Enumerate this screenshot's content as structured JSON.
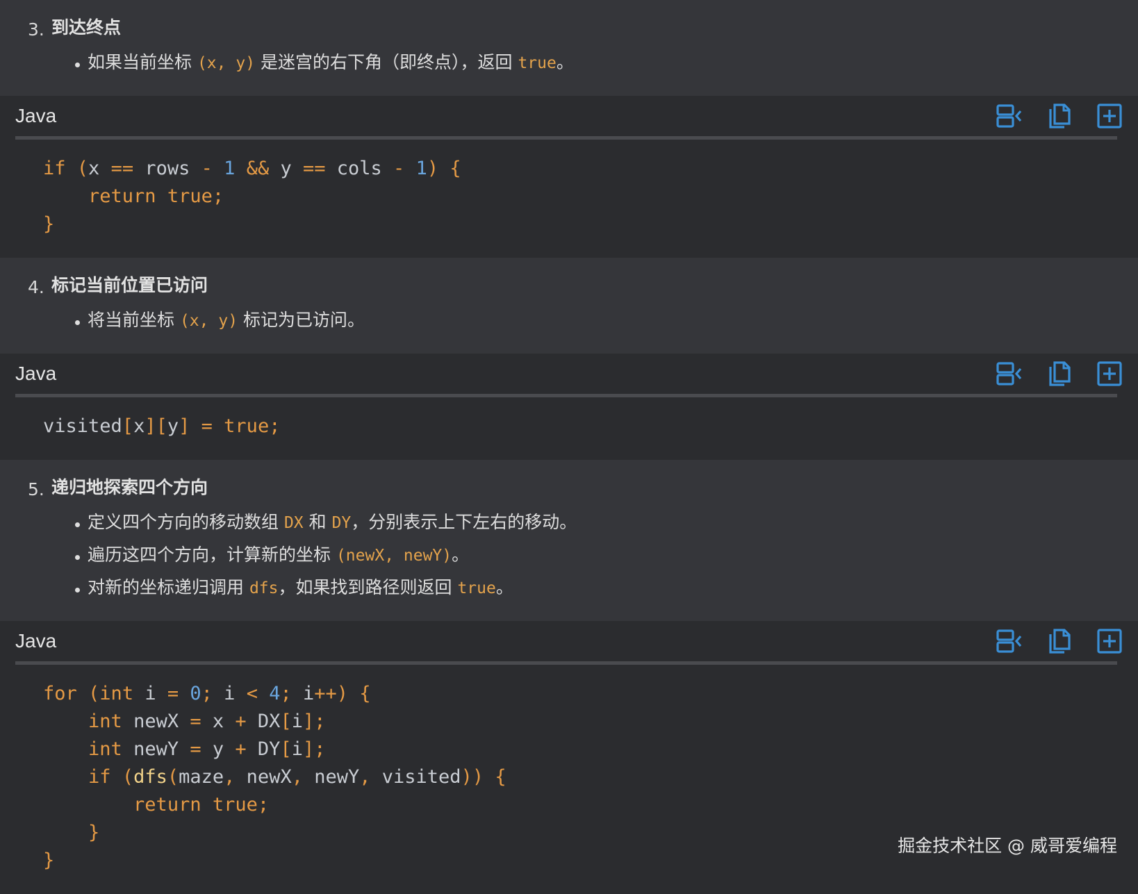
{
  "sections": [
    {
      "num": "3.",
      "title": "到达终点",
      "bullets": [
        [
          {
            "t": "如果当前坐标 "
          },
          {
            "t": "(x, y)",
            "code": true
          },
          {
            "t": " 是迷宫的右下角（即终点），返回 "
          },
          {
            "t": "true",
            "code": true
          },
          {
            "t": "。"
          }
        ]
      ]
    },
    {
      "num": "4.",
      "title": "标记当前位置已访问",
      "bullets": [
        [
          {
            "t": "将当前坐标 "
          },
          {
            "t": "(x, y)",
            "code": true
          },
          {
            "t": " 标记为已访问。"
          }
        ]
      ]
    },
    {
      "num": "5.",
      "title": "递归地探索四个方向",
      "bullets": [
        [
          {
            "t": "定义四个方向的移动数组 "
          },
          {
            "t": "DX",
            "code": true
          },
          {
            "t": " 和 "
          },
          {
            "t": "DY",
            "code": true
          },
          {
            "t": "，分别表示上下左右的移动。"
          }
        ],
        [
          {
            "t": "遍历这四个方向，计算新的坐标 "
          },
          {
            "t": "(newX, newY)",
            "code": true
          },
          {
            "t": "。"
          }
        ],
        [
          {
            "t": "对新的坐标递归调用 "
          },
          {
            "t": "dfs",
            "code": true
          },
          {
            "t": "，如果找到路径则返回 "
          },
          {
            "t": "true",
            "code": true
          },
          {
            "t": "。"
          }
        ]
      ]
    }
  ],
  "code_blocks": [
    {
      "lang": "Java",
      "lines": [
        [
          {
            "t": "if",
            "c": "kw"
          },
          {
            "t": " "
          },
          {
            "t": "(",
            "c": "op"
          },
          {
            "t": "x "
          },
          {
            "t": "==",
            "c": "op"
          },
          {
            "t": " rows "
          },
          {
            "t": "-",
            "c": "op"
          },
          {
            "t": " "
          },
          {
            "t": "1",
            "c": "num"
          },
          {
            "t": " "
          },
          {
            "t": "&&",
            "c": "op"
          },
          {
            "t": " y "
          },
          {
            "t": "==",
            "c": "op"
          },
          {
            "t": " cols "
          },
          {
            "t": "-",
            "c": "op"
          },
          {
            "t": " "
          },
          {
            "t": "1",
            "c": "num"
          },
          {
            "t": ")",
            "c": "op"
          },
          {
            "t": " "
          },
          {
            "t": "{",
            "c": "op"
          }
        ],
        [
          {
            "t": "    "
          },
          {
            "t": "return true;",
            "c": "kw"
          }
        ],
        [
          {
            "t": "}",
            "c": "op"
          }
        ]
      ]
    },
    {
      "lang": "Java",
      "lines": [
        [
          {
            "t": "visited"
          },
          {
            "t": "[",
            "c": "op"
          },
          {
            "t": "x"
          },
          {
            "t": "][",
            "c": "op"
          },
          {
            "t": "y"
          },
          {
            "t": "]",
            "c": "op"
          },
          {
            "t": " "
          },
          {
            "t": "=",
            "c": "op"
          },
          {
            "t": " "
          },
          {
            "t": "true;",
            "c": "kw"
          }
        ]
      ]
    },
    {
      "lang": "Java",
      "lines": [
        [
          {
            "t": "for",
            "c": "kw"
          },
          {
            "t": " "
          },
          {
            "t": "(int",
            "c": "kw"
          },
          {
            "t": " i "
          },
          {
            "t": "=",
            "c": "op"
          },
          {
            "t": " "
          },
          {
            "t": "0",
            "c": "num"
          },
          {
            "t": ";",
            "c": "op"
          },
          {
            "t": " i "
          },
          {
            "t": "<",
            "c": "op"
          },
          {
            "t": " "
          },
          {
            "t": "4",
            "c": "num"
          },
          {
            "t": ";",
            "c": "op"
          },
          {
            "t": " i"
          },
          {
            "t": "++)",
            "c": "op"
          },
          {
            "t": " "
          },
          {
            "t": "{",
            "c": "op"
          }
        ],
        [
          {
            "t": "    "
          },
          {
            "t": "int",
            "c": "kw"
          },
          {
            "t": " newX "
          },
          {
            "t": "=",
            "c": "op"
          },
          {
            "t": " x "
          },
          {
            "t": "+",
            "c": "op"
          },
          {
            "t": " DX"
          },
          {
            "t": "[",
            "c": "op"
          },
          {
            "t": "i"
          },
          {
            "t": "];",
            "c": "op"
          }
        ],
        [
          {
            "t": "    "
          },
          {
            "t": "int",
            "c": "kw"
          },
          {
            "t": " newY "
          },
          {
            "t": "=",
            "c": "op"
          },
          {
            "t": " y "
          },
          {
            "t": "+",
            "c": "op"
          },
          {
            "t": " DY"
          },
          {
            "t": "[",
            "c": "op"
          },
          {
            "t": "i"
          },
          {
            "t": "];",
            "c": "op"
          }
        ],
        [
          {
            "t": "    "
          },
          {
            "t": "if",
            "c": "kw"
          },
          {
            "t": " "
          },
          {
            "t": "(",
            "c": "op"
          },
          {
            "t": "dfs",
            "c": "fn"
          },
          {
            "t": "(",
            "c": "op"
          },
          {
            "t": "maze"
          },
          {
            "t": ",",
            "c": "op"
          },
          {
            "t": " newX"
          },
          {
            "t": ",",
            "c": "op"
          },
          {
            "t": " newY"
          },
          {
            "t": ",",
            "c": "op"
          },
          {
            "t": " visited"
          },
          {
            "t": "))",
            "c": "op"
          },
          {
            "t": " "
          },
          {
            "t": "{",
            "c": "op"
          }
        ],
        [
          {
            "t": "        "
          },
          {
            "t": "return true;",
            "c": "kw"
          }
        ],
        [
          {
            "t": "    "
          },
          {
            "t": "}",
            "c": "op"
          }
        ],
        [
          {
            "t": "}",
            "c": "op"
          }
        ]
      ]
    }
  ],
  "toolbar_icons": [
    "collapse-lines-icon",
    "copy-icon",
    "insert-icon"
  ],
  "watermark": "掘金技术社区 @ 威哥爱编程",
  "colors": {
    "accent_icon": "#3a8fd6",
    "keyword": "#e59a45",
    "number": "#6aa6df",
    "inline_code": "#e4a34c",
    "section_bg": "#35363a",
    "code_bg": "#2b2c2f"
  }
}
